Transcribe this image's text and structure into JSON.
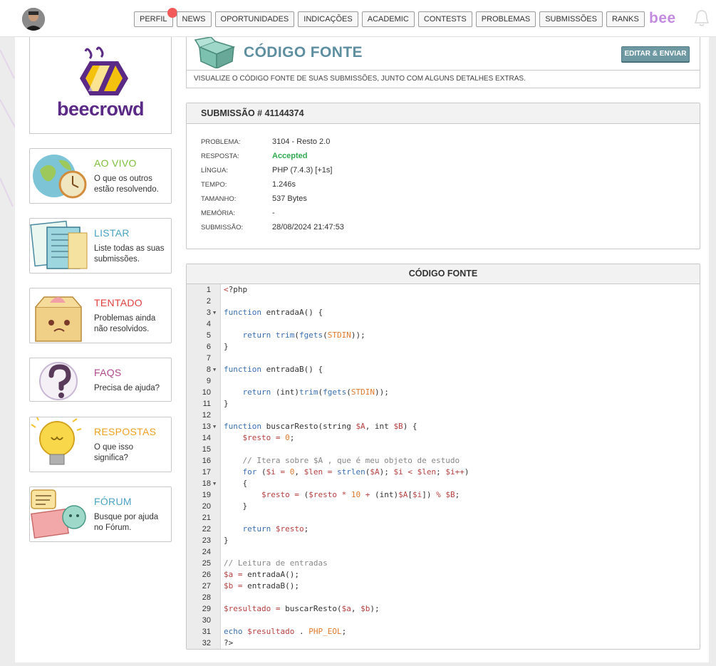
{
  "nav": {
    "items": [
      "PERFIL",
      "NEWS",
      "OPORTUNIDADES",
      "INDICAÇÕES",
      "ACADEMIC",
      "CONTESTS",
      "PROBLEMAS",
      "SUBMISSÕES",
      "RANKS"
    ],
    "brand": "bee"
  },
  "sidebar": {
    "logo_text": "beecrowd",
    "cards": [
      {
        "title": "AO VIVO",
        "desc": "O que os outros estão resolvendo.",
        "color": "#7fbf3f"
      },
      {
        "title": "LISTAR",
        "desc": "Liste todas as suas submissões.",
        "color": "#4ba3c3"
      },
      {
        "title": "TENTADO",
        "desc": "Problemas ainda não resolvidos.",
        "color": "#e0403f"
      },
      {
        "title": "FAQS",
        "desc": "Precisa de ajuda?",
        "color": "#b04a8a"
      },
      {
        "title": "RESPOSTAS",
        "desc": "O que isso significa?",
        "color": "#f0a020"
      },
      {
        "title": "FÓRUM",
        "desc": "Busque por ajuda no Fórum.",
        "color": "#4ba3c3"
      }
    ]
  },
  "header": {
    "title": "CÓDIGO FONTE",
    "edit_button": "EDITAR & ENVIAR",
    "description": "VISUALIZE O CÓDIGO FONTE DE SUAS SUBMISSÕES, JUNTO COM ALGUNS DETALHES EXTRAS."
  },
  "submission": {
    "heading": "SUBMISSÃO # 41144374",
    "rows": [
      {
        "key": "PROBLEMA:",
        "value": "3104 - Resto 2.0"
      },
      {
        "key": "RESPOSTA:",
        "value": "Accepted"
      },
      {
        "key": "LÍNGUA:",
        "value": "PHP (7.4.3) [+1s]"
      },
      {
        "key": "TEMPO:",
        "value": "1.246s"
      },
      {
        "key": "TAMANHO:",
        "value": "537 Bytes"
      },
      {
        "key": "MEMÓRIA:",
        "value": "-"
      },
      {
        "key": "SUBMISSÃO:",
        "value": "28/08/2024 21:47:53"
      }
    ]
  },
  "code": {
    "heading": "CÓDIGO FONTE",
    "fold_lines": [
      3,
      8,
      13,
      18
    ],
    "lines": [
      "<?php",
      "",
      "function entradaA() {",
      "",
      "    return trim(fgets(STDIN));",
      "}",
      "",
      "function entradaB() {",
      "",
      "    return (int)trim(fgets(STDIN));",
      "}",
      "",
      "function buscarResto(string $A, int $B) {",
      "    $resto = 0;",
      "",
      "    // Itera sobre $A , que é meu objeto de estudo",
      "    for ($i = 0, $len = strlen($A); $i < $len; $i++)",
      "    {",
      "        $resto = ($resto * 10 + (int)$A[$i]) % $B;",
      "    }",
      "",
      "    return $resto;",
      "}",
      "",
      "// Leitura de entradas",
      "$a = entradaA();",
      "$b = entradaB();",
      "",
      "$resultado = buscarResto($a, $b);",
      "",
      "echo $resultado . PHP_EOL;",
      "?>"
    ]
  }
}
